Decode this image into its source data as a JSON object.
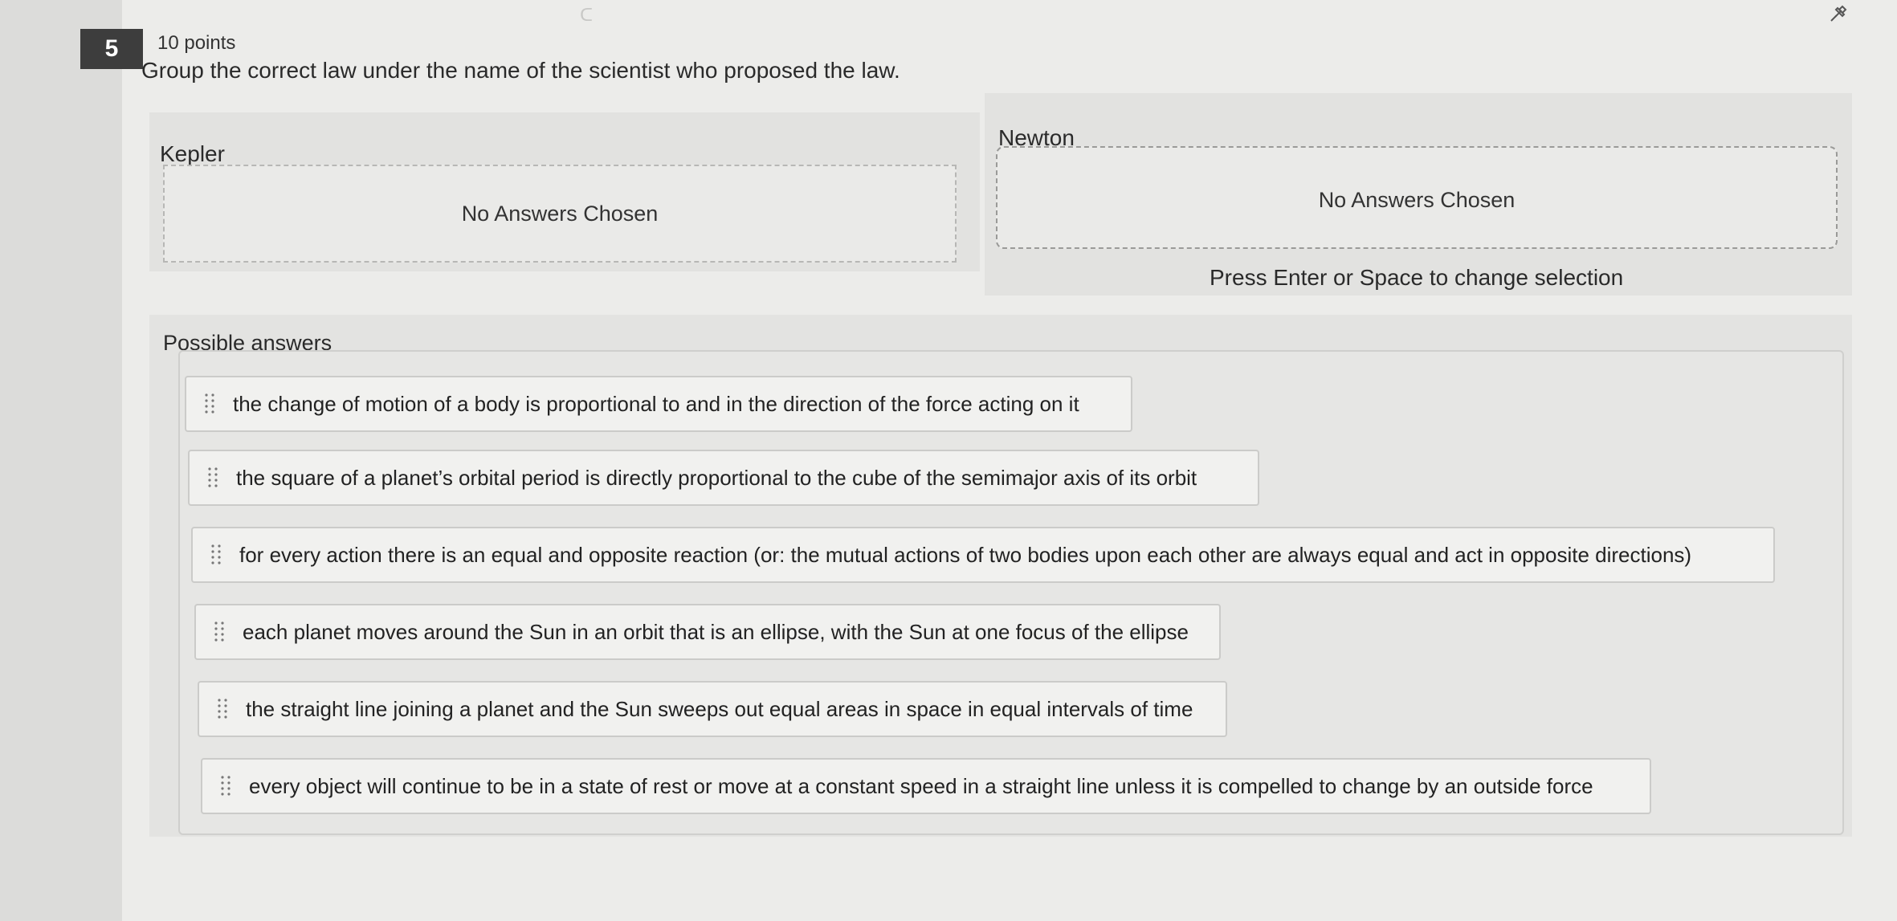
{
  "question": {
    "number": "5",
    "points": "10 points",
    "prompt": "Group the correct law under the name of the scientist who proposed the law."
  },
  "groups": [
    {
      "label": "Kepler",
      "empty_text": "No Answers Chosen"
    },
    {
      "label": "Newton",
      "empty_text": "No Answers Chosen"
    }
  ],
  "hint": "Press Enter or Space to change selection",
  "answers": {
    "label": "Possible answers",
    "items": [
      {
        "text": "the change of motion of a body is proportional to and in the direction of the force acting on it"
      },
      {
        "text": "the square of a planet’s orbital period is directly proportional to the cube of the semimajor axis of its orbit"
      },
      {
        "text": "for every action there is an equal and opposite reaction (or: the mutual actions of two bodies upon each other are always equal and act in opposite directions)"
      },
      {
        "text": "each planet moves around the Sun in an orbit that is an ellipse, with the Sun at one focus of the ellipse"
      },
      {
        "text": "the straight line joining a planet and the Sun sweeps out equal areas in space in equal intervals of time"
      },
      {
        "text": "every object will continue to be in a state of rest or move at a constant speed in a straight line unless it is compelled to change by an outside force"
      }
    ]
  },
  "icons": {
    "pin": "pin-icon",
    "drag_handle": "drag-handle-icon"
  },
  "colors": {
    "question_badge": "#3d3d3d",
    "background": "#ececea"
  }
}
